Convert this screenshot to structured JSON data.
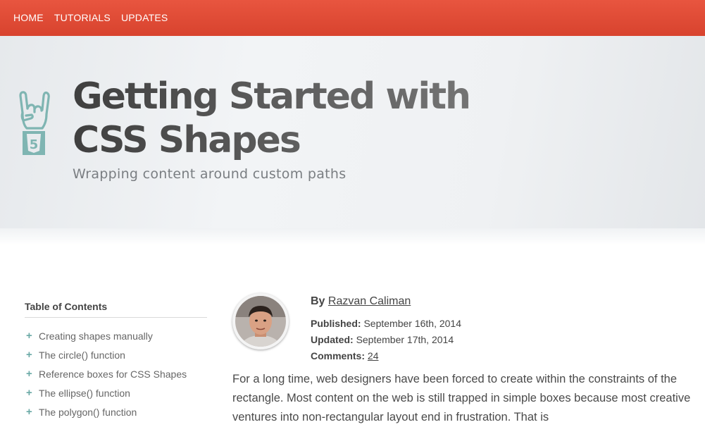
{
  "nav": {
    "items": [
      "HOME",
      "TUTORIALS",
      "UPDATES"
    ],
    "bg_color": "#e04d38"
  },
  "hero": {
    "icon": "html5-rock-hand-icon",
    "title": "Getting Started with CSS Shapes",
    "subtitle": "Wrapping content around custom paths"
  },
  "toc": {
    "title": "Table of Contents",
    "items": [
      "Creating shapes manually",
      "The circle() function",
      "Reference boxes for CSS Shapes",
      "The ellipse() function",
      "The polygon() function"
    ],
    "bullet_color": "#6aa9a6"
  },
  "author": {
    "by_label": "By",
    "name": "Razvan Caliman",
    "published_label": "Published:",
    "published": "September 16th, 2014",
    "updated_label": "Updated:",
    "updated": "September 17th, 2014",
    "comments_label": "Comments:",
    "comments": "24"
  },
  "article": {
    "intro": "For a long time, web designers have been forced to create within the constraints of the rectangle. Most content on the web is still trapped in simple boxes because most creative ventures into non-rectangular layout end in frustration. That is"
  }
}
